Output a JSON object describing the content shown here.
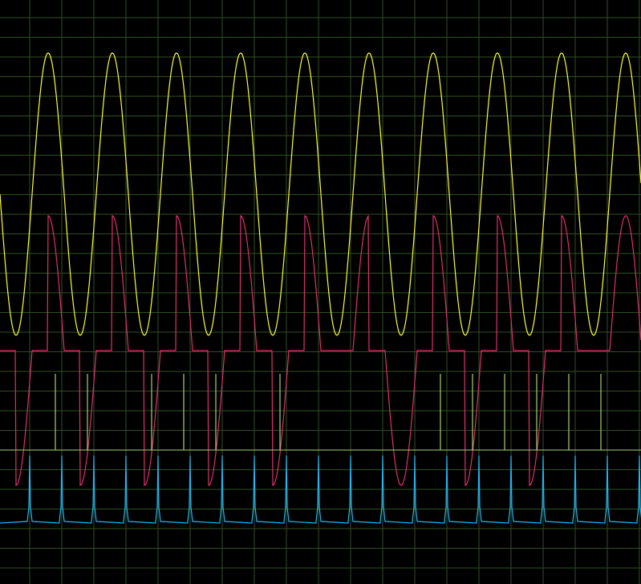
{
  "chart_data": {
    "type": "line",
    "title": "",
    "xlabel": "",
    "ylabel": "",
    "grid": true,
    "legend": "none",
    "colors": {
      "background": "#000000",
      "grid": "#2f4f23",
      "sine": "#ffff33",
      "rectified": "#e0306e",
      "gate": "#a8d36a",
      "pulse": "#22b6f2"
    },
    "x_range": [
      0,
      10
    ],
    "y_range": [
      -1.1,
      1.1
    ],
    "series": [
      {
        "key": "sine",
        "kind": "sine",
        "cycles": 10,
        "phase_start": 0.0,
        "amplitude": 1.0
      },
      {
        "key": "rectified",
        "kind": "gated-sine",
        "cycles": 10,
        "phase_start": 0.0,
        "gates": [
          "pos",
          "neg",
          "pos",
          "neg",
          "pos",
          "neg",
          "pos",
          "neg",
          "pos",
          "neg",
          "pos",
          "pos",
          "neg",
          "neg",
          "pos",
          "neg",
          "pos",
          "neg",
          "pos",
          "pos"
        ]
      },
      {
        "key": "gate",
        "kind": "impulse",
        "times": [
          0.4,
          0.9,
          1.9,
          2.4,
          2.9,
          3.9,
          6.4,
          6.9,
          7.4,
          7.9,
          8.4,
          8.9
        ]
      },
      {
        "key": "pulse",
        "kind": "spike",
        "period": 0.5,
        "count": 20,
        "high": 1.0,
        "low": 0.0
      }
    ]
  }
}
